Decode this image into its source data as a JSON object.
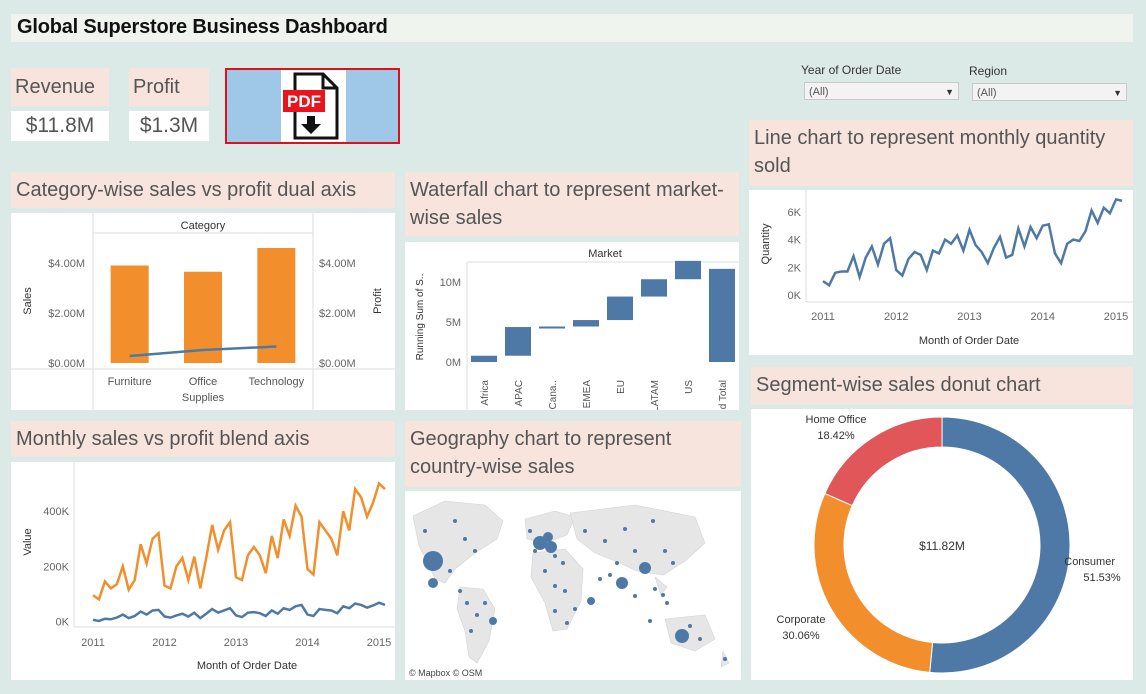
{
  "dashboard_title": "Global Superstore Business Dashboard",
  "kpis": {
    "revenue": {
      "label": "Revenue",
      "value": "$11.8M"
    },
    "profit": {
      "label": "Profit",
      "value": "$1.3M"
    }
  },
  "pdf_button": {
    "label": "PDF"
  },
  "filters": [
    {
      "label": "Year of Order Date",
      "value": "(All)"
    },
    {
      "label": "Region",
      "value": "(All)"
    }
  ],
  "sections": {
    "category": "Category-wise sales vs profit dual axis",
    "waterfall": "Waterfall chart to represent market-wise sales",
    "line_qty": "Line chart to represent monthly quantity sold",
    "monthly": "Monthly sales vs profit blend axis",
    "geo": "Geography chart to represent country-wise sales",
    "donut": "Segment-wise sales donut chart"
  },
  "colors": {
    "orange": "#f28e2b",
    "blue": "#4e79a7",
    "red": "#e15759"
  },
  "map_attribution": "© Mapbox © OSM",
  "chart_data": [
    {
      "id": "category",
      "type": "bar",
      "header": "Category",
      "categories": [
        "Furniture",
        "Office Supplies",
        "Technology"
      ],
      "category_lines": [
        [
          "Furniture"
        ],
        [
          "Office",
          "Supplies"
        ],
        [
          "Technology"
        ]
      ],
      "series": [
        {
          "name": "Sales",
          "values": [
            3900000,
            3650000,
            4600000
          ],
          "mark": "bar",
          "color": "#f28e2b"
        },
        {
          "name": "Profit",
          "values": [
            280000,
            520000,
            660000
          ],
          "mark": "line",
          "color": "#4e79a7"
        }
      ],
      "ylabel": "Sales",
      "y2label": "Profit",
      "yticks": [
        "$0.00M",
        "$2.00M",
        "$4.00M"
      ],
      "y2ticks": [
        "$0.00M",
        "$2.00M",
        "$4.00M"
      ],
      "ylim": [
        0,
        5000000
      ]
    },
    {
      "id": "waterfall",
      "type": "bar",
      "header": "Market",
      "categories": [
        "Africa",
        "APAC",
        "Cana..",
        "EMEA",
        "EU",
        "LATAM",
        "US",
        "Grand Total"
      ],
      "values": [
        783773,
        3585745,
        66929,
        806161,
        2938089,
        2164605,
        2297201,
        11642503
      ],
      "ylabel": "Running Sum of S..",
      "yticks": [
        "0M",
        "5M",
        "10M"
      ],
      "ylim": [
        -1500000,
        12500000
      ]
    },
    {
      "id": "line_qty",
      "type": "line",
      "x": [
        "2011",
        "2012",
        "2013",
        "2014",
        "2015"
      ],
      "values": [
        1000,
        700,
        1600,
        1700,
        1700,
        2800,
        1300,
        2700,
        3500,
        2200,
        3700,
        4100,
        1800,
        1400,
        2600,
        3100,
        2900,
        1800,
        3200,
        3000,
        4000,
        3700,
        4300,
        3200,
        4700,
        3600,
        3100,
        2300,
        3400,
        4200,
        2700,
        2900,
        4800,
        3500,
        4900,
        4100,
        5000,
        5100,
        3000,
        2300,
        3700,
        4000,
        3900,
        4600,
        6100,
        5200,
        6300,
        5900,
        6900,
        6800
      ],
      "xlabel": "Month of Order Date",
      "ylabel": "Quantity",
      "yticks": [
        "0K",
        "2K",
        "4K",
        "6K"
      ],
      "ylim": [
        0,
        7000
      ]
    },
    {
      "id": "monthly",
      "type": "line",
      "x": [
        "2011",
        "2012",
        "2013",
        "2014",
        "2015"
      ],
      "series": [
        {
          "name": "Sales",
          "color": "#f28e2b",
          "values": [
            95000,
            80000,
            145000,
            120000,
            135000,
            200000,
            115000,
            150000,
            280000,
            210000,
            300000,
            320000,
            130000,
            120000,
            200000,
            230000,
            150000,
            235000,
            120000,
            230000,
            350000,
            260000,
            330000,
            360000,
            160000,
            150000,
            240000,
            270000,
            240000,
            175000,
            310000,
            230000,
            370000,
            310000,
            420000,
            380000,
            190000,
            170000,
            360000,
            330000,
            300000,
            240000,
            400000,
            330000,
            480000,
            450000,
            380000,
            430000,
            500000,
            480000
          ]
        },
        {
          "name": "Profit",
          "color": "#4e79a7",
          "values": [
            6000,
            2000,
            10000,
            8000,
            14000,
            25000,
            12000,
            20000,
            36000,
            25000,
            40000,
            42000,
            18000,
            14000,
            22000,
            28000,
            18000,
            32000,
            12000,
            28000,
            45000,
            32000,
            40000,
            48000,
            22000,
            16000,
            32000,
            34000,
            30000,
            20000,
            40000,
            28000,
            48000,
            42000,
            55000,
            60000,
            25000,
            20000,
            45000,
            42000,
            40000,
            30000,
            55000,
            48000,
            65000,
            60000,
            50000,
            58000,
            68000,
            60000
          ]
        }
      ],
      "xlabel": "Month of Order Date",
      "ylabel": "Value",
      "yticks": [
        "0K",
        "200K",
        "400K"
      ],
      "ylim": [
        -20000,
        560000
      ]
    },
    {
      "id": "donut",
      "type": "pie",
      "center_label": "$11.82M",
      "slices": [
        {
          "name": "Consumer",
          "percent": 51.53,
          "label": "51.53%",
          "color": "#4e79a7"
        },
        {
          "name": "Corporate",
          "percent": 30.06,
          "label": "30.06%",
          "color": "#f28e2b"
        },
        {
          "name": "Home Office",
          "percent": 18.42,
          "label": "18.42%",
          "color": "#e15759"
        }
      ]
    }
  ]
}
